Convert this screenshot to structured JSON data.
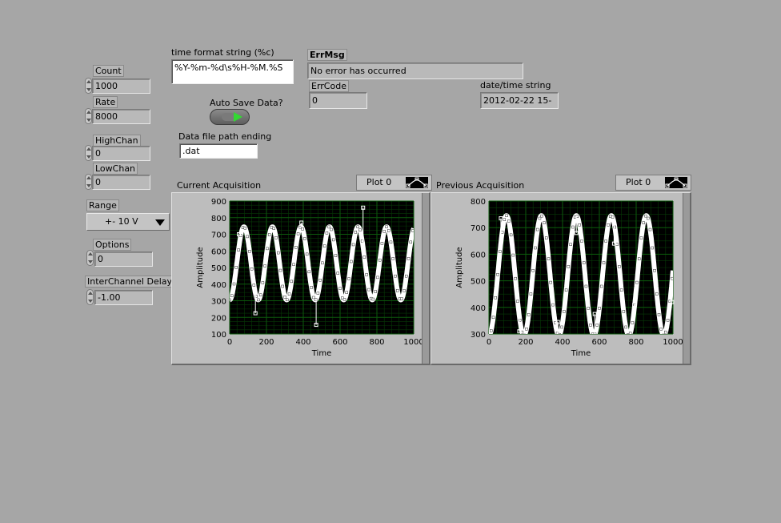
{
  "controls": {
    "count": {
      "label": "Count",
      "value": "1000"
    },
    "rate": {
      "label": "Rate",
      "value": "8000"
    },
    "highchan": {
      "label": "HighChan",
      "value": "0"
    },
    "lowchan": {
      "label": "LowChan",
      "value": "0"
    },
    "range": {
      "label": "Range",
      "value": "+- 10 V"
    },
    "options": {
      "label": "Options",
      "value": "0"
    },
    "interchannel_delay": {
      "label": "InterChannel Delay",
      "value": "-1.00"
    },
    "time_format": {
      "label": "time format string (%c)",
      "value": "%Y-%m-%d\\s%H-%M.%S"
    },
    "auto_save": {
      "label": "Auto Save Data?"
    },
    "file_ending": {
      "label": "Data file path ending",
      "value": ".dat"
    }
  },
  "error": {
    "errmsg_label": "ErrMsg",
    "errmsg_value": "No error has occurred",
    "errcode_label": "ErrCode",
    "errcode_value": "0"
  },
  "datetime": {
    "label": "date/time string",
    "value": "2012-02-22 15-"
  },
  "graphs": [
    {
      "title": "Current Acquisition",
      "legend": "Plot 0"
    },
    {
      "title": "Previous Acquisition",
      "legend": "Plot 0"
    }
  ],
  "colors": {
    "background": "#a6a6a6",
    "plot_bg": "#000000",
    "grid": "#0c5a0c",
    "trace": "#ffffff",
    "led_on": "#32d832"
  },
  "chart_data": [
    {
      "type": "line",
      "title": "Current Acquisition",
      "xlabel": "Time",
      "ylabel": "Amplitude",
      "xlim": [
        0,
        1000
      ],
      "ylim": [
        100,
        900
      ],
      "xticks": [
        0,
        200,
        400,
        600,
        800,
        1000
      ],
      "yticks": [
        100,
        200,
        300,
        400,
        500,
        600,
        700,
        800,
        900
      ],
      "series": [
        {
          "name": "Plot 0",
          "amplitude": 220,
          "offset": 525,
          "period": 155,
          "points": 1000
        }
      ],
      "spikes": [
        {
          "x": 50,
          "y": 700
        },
        {
          "x": 140,
          "y": 225
        },
        {
          "x": 390,
          "y": 770
        },
        {
          "x": 470,
          "y": 155
        },
        {
          "x": 725,
          "y": 860
        }
      ],
      "grid": true
    },
    {
      "type": "line",
      "title": "Previous Acquisition",
      "xlabel": "Time",
      "ylabel": "Amplitude",
      "xlim": [
        0,
        1000
      ],
      "ylim": [
        300,
        800
      ],
      "xticks": [
        0,
        200,
        400,
        600,
        800,
        1000
      ],
      "yticks": [
        300,
        400,
        500,
        600,
        700,
        800
      ],
      "series": [
        {
          "name": "Plot 0",
          "amplitude": 225,
          "offset": 520,
          "period": 190,
          "points": 1000
        }
      ],
      "spikes": [
        {
          "x": 65,
          "y": 735
        },
        {
          "x": 165,
          "y": 310
        },
        {
          "x": 270,
          "y": 710
        },
        {
          "x": 375,
          "y": 345
        },
        {
          "x": 475,
          "y": 680
        },
        {
          "x": 575,
          "y": 375
        },
        {
          "x": 680,
          "y": 640
        },
        {
          "x": 790,
          "y": 410
        },
        {
          "x": 995,
          "y": 420
        }
      ],
      "grid": true
    }
  ]
}
